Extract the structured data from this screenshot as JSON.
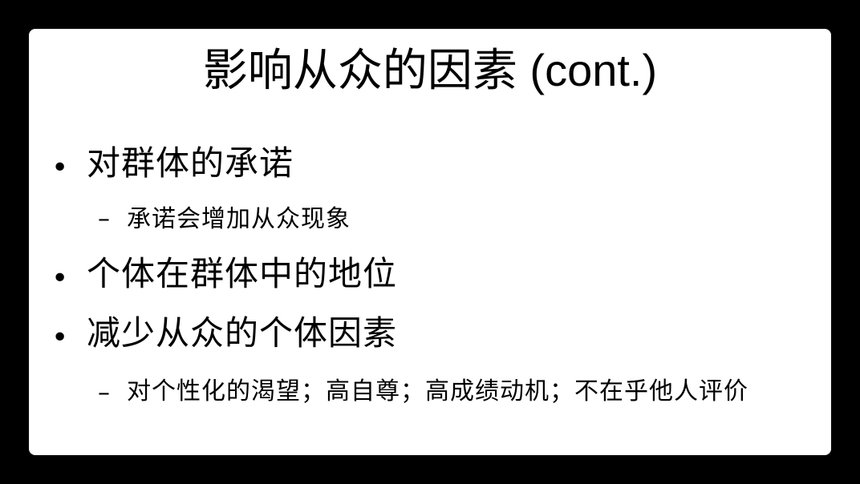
{
  "slide": {
    "title": "影响从众的因素 (cont.)",
    "items": [
      {
        "text": "对群体的承诺",
        "subitems": [
          "承诺会增加从众现象"
        ]
      },
      {
        "text": "个体在群体中的地位",
        "subitems": []
      },
      {
        "text": "减少从众的个体因素",
        "subitems": [
          "对个性化的渴望；高自尊；高成绩动机；不在乎他人评价"
        ]
      }
    ],
    "bullet_glyph": "•",
    "dash_glyph": "–"
  }
}
